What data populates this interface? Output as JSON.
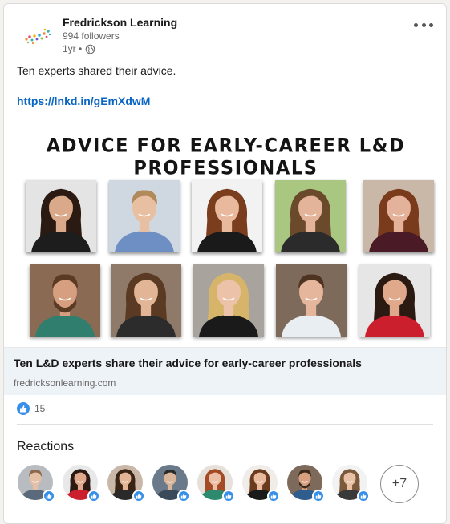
{
  "post": {
    "author_name": "Fredrickson Learning",
    "followers": "994 followers",
    "time": "1yr •",
    "visibility_icon": "globe-icon",
    "more_icon": "more-options-icon",
    "commentary": "Ten experts shared their advice.",
    "link": "https://lnkd.in/gEmXdwM"
  },
  "image": {
    "title": "ADVICE FOR EARLY-CAREER L&D PROFESSIONALS",
    "photos": [
      {
        "name": "expert-photo-1"
      },
      {
        "name": "expert-photo-2"
      },
      {
        "name": "expert-photo-3"
      },
      {
        "name": "expert-photo-4"
      },
      {
        "name": "expert-photo-5"
      },
      {
        "name": "expert-photo-6"
      },
      {
        "name": "expert-photo-7"
      },
      {
        "name": "expert-photo-8"
      },
      {
        "name": "expert-photo-9"
      },
      {
        "name": "expert-photo-10"
      }
    ]
  },
  "preview": {
    "title": "Ten L&D experts share their advice for early-career professionals",
    "domain": "fredricksonlearning.com"
  },
  "social": {
    "like_icon": "like-icon",
    "count": "15"
  },
  "reactions": {
    "title": "Reactions",
    "more": "+7"
  },
  "colors": {
    "link": "#0a66c2",
    "like": "#378fe9",
    "preview_bg": "#eef3f8"
  }
}
